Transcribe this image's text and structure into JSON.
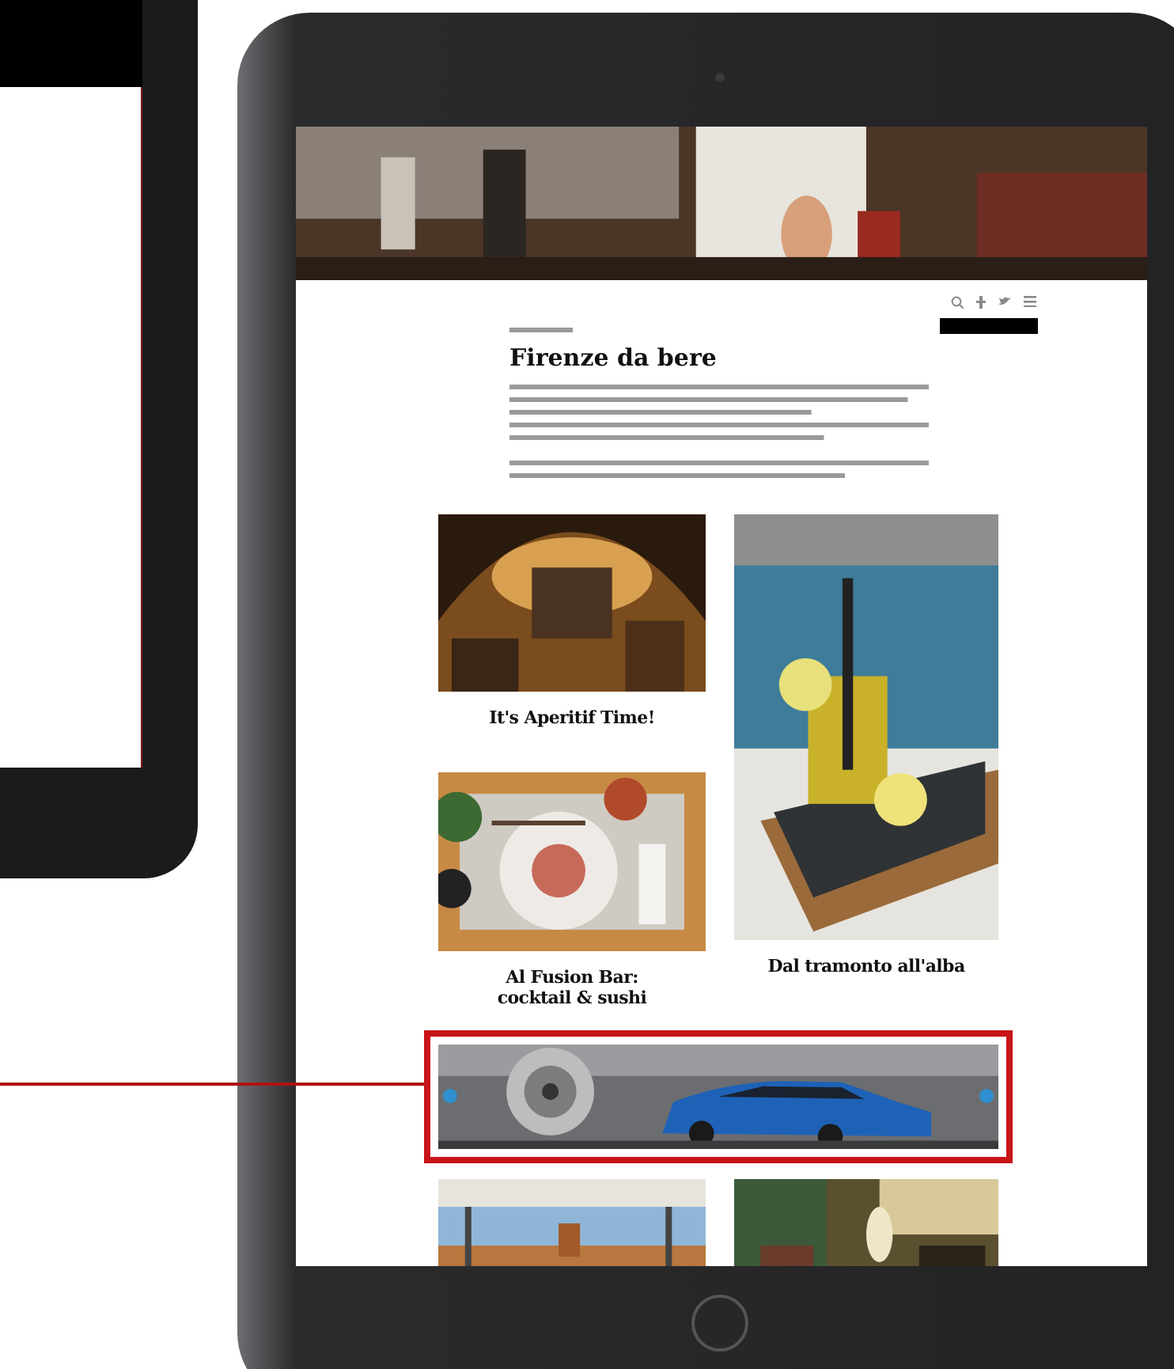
{
  "article": {
    "title": "Firenze da bere"
  },
  "cards": [
    {
      "title": "It's Aperitif Time!",
      "kind": "interior"
    },
    {
      "title": "Dal tramonto all'alba",
      "kind": "drink"
    },
    {
      "title": "Al Fusion Bar: cocktail & sushi",
      "kind": "plate"
    }
  ],
  "banner": {
    "highlighted": true
  }
}
